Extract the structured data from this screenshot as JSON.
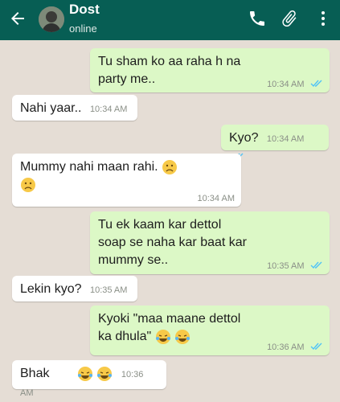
{
  "header": {
    "contact_name": "Dost",
    "status": "online",
    "icons": [
      "back-arrow-icon",
      "avatar",
      "phone-icon",
      "paperclip-icon",
      "more-vert-icon"
    ],
    "color": "#075e54"
  },
  "colors": {
    "outgoing": "#dcf8c6",
    "incoming": "#ffffff",
    "background": "#e5ddd5",
    "read_tick": "#4fc3f7"
  },
  "messages": [
    {
      "direction": "out",
      "lines": [
        "Tu sham ko aa raha h na",
        "party me.."
      ],
      "time": "10:34 AM"
    },
    {
      "direction": "in",
      "text": "Nahi yaar..",
      "time": "10:34 AM"
    },
    {
      "direction": "out",
      "text": "Kyo?",
      "time": "10:34 AM"
    },
    {
      "direction": "in",
      "text": "Mummy nahi maan rahi.",
      "time": "10:34 AM",
      "emoji": [
        "sad-face",
        "sad-face"
      ]
    },
    {
      "direction": "out",
      "lines": [
        "Tu ek kaam kar dettol",
        "soap se naha kar baat kar",
        "mummy se.."
      ],
      "time": "10:35 AM"
    },
    {
      "direction": "in",
      "text": "Lekin kyo?",
      "time": "10:35 AM"
    },
    {
      "direction": "out",
      "lines": [
        "Kyoki \"maa maane dettol",
        "ka dhula\""
      ],
      "time": "10:36 AM",
      "emoji": [
        "laughing-tears",
        "laughing-tears"
      ]
    },
    {
      "direction": "in",
      "text": "Bhak",
      "time": "10:36 AM",
      "emoji": [
        "laughing-tears",
        "laughing-tears"
      ]
    }
  ]
}
